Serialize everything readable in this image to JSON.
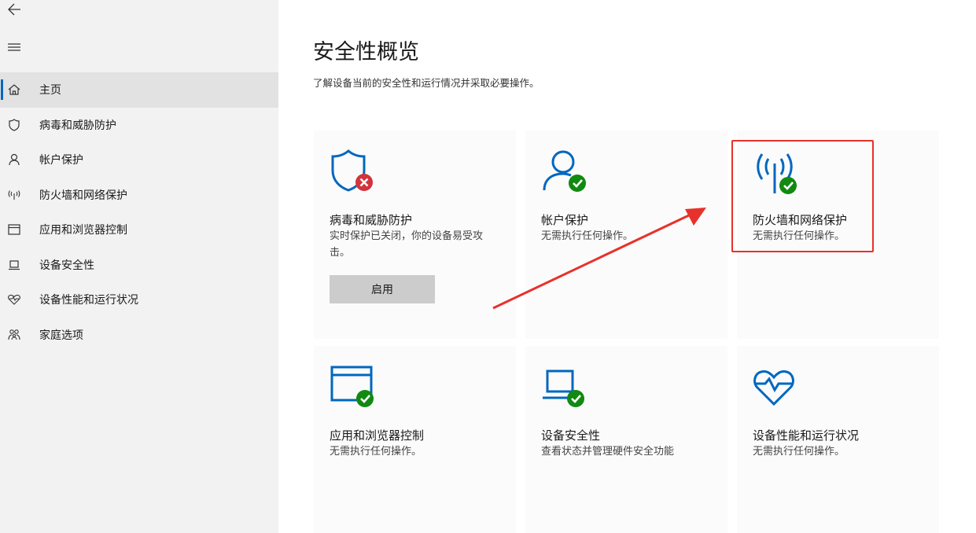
{
  "sidebar": {
    "back_icon": "back-arrow-icon",
    "menu_icon": "hamburger-menu-icon",
    "items": [
      {
        "label": "主页",
        "icon": "home-icon",
        "active": true
      },
      {
        "label": "病毒和威胁防护",
        "icon": "shield-icon",
        "active": false
      },
      {
        "label": "帐户保护",
        "icon": "person-icon",
        "active": false
      },
      {
        "label": "防火墙和网络保护",
        "icon": "wifi-antenna-icon",
        "active": false
      },
      {
        "label": "应用和浏览器控制",
        "icon": "browser-window-icon",
        "active": false
      },
      {
        "label": "设备安全性",
        "icon": "laptop-icon",
        "active": false
      },
      {
        "label": "设备性能和运行状况",
        "icon": "heart-pulse-icon",
        "active": false
      },
      {
        "label": "家庭选项",
        "icon": "family-icon",
        "active": false
      }
    ]
  },
  "main": {
    "title": "安全性概览",
    "subtitle": "了解设备当前的安全性和运行情况并采取必要操作。",
    "cards": [
      {
        "title": "病毒和威胁防护",
        "desc": "实时保护已关闭，你的设备易受攻击。",
        "button": "启用",
        "icon": "shield-icon",
        "status": "error"
      },
      {
        "title": "帐户保护",
        "desc": "无需执行任何操作。",
        "icon": "person-icon",
        "status": "ok"
      },
      {
        "title": "防火墙和网络保护",
        "desc": "无需执行任何操作。",
        "icon": "wifi-antenna-icon",
        "status": "ok"
      },
      {
        "title": "应用和浏览器控制",
        "desc": "无需执行任何操作。",
        "icon": "browser-window-icon",
        "status": "ok"
      },
      {
        "title": "设备安全性",
        "desc": "查看状态并管理硬件安全功能",
        "icon": "laptop-icon",
        "status": "ok"
      },
      {
        "title": "设备性能和运行状况",
        "desc": "无需执行任何操作。",
        "icon": "heart-pulse-icon",
        "status": "ok"
      }
    ]
  },
  "colors": {
    "accent": "#0067c0",
    "ok_green": "#108a10",
    "error_red": "#d1343c",
    "annotation_red": "#e8312b"
  }
}
